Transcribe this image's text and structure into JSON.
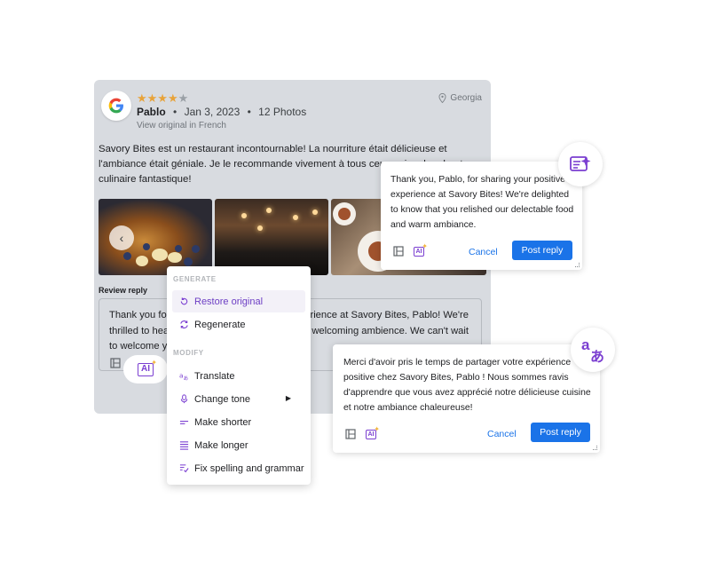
{
  "review": {
    "stars_filled": "★★★★",
    "stars_empty": "★",
    "rating": 4,
    "author": "Pablo",
    "date": "Jan 3, 2023",
    "photos_count": "12 Photos",
    "view_original": "View original in French",
    "location": "Georgia",
    "text": "Savory Bites est un restaurant incontournable! La nourriture était délicieuse et l'ambiance était géniale. Je le recommande vivement à tous ceux qui recherchent",
    "text_end": "culinaire fantastique!",
    "reply_label": "Review reply",
    "reply_text_left": "Thank you for t",
    "reply_text_right_1": "experience at Savory Bites, Pablo! We're",
    "reply_text_line2_left": "thrilled to hear",
    "reply_text_right_2": "and welcoming ambience. We can't wait",
    "reply_text_line3": "to welcome yo",
    "ai_label": "AI"
  },
  "menu": {
    "generate_header": "GENERATE",
    "modify_header": "MODIFY",
    "items": [
      {
        "label": "Restore original",
        "icon": "restore-icon",
        "active": true
      },
      {
        "label": "Regenerate",
        "icon": "regenerate-icon"
      },
      {
        "label": "Translate",
        "icon": "translate-icon"
      },
      {
        "label": "Change tone",
        "icon": "tone-icon",
        "submenu": "▶"
      },
      {
        "label": "Make shorter",
        "icon": "shorter-icon"
      },
      {
        "label": "Make longer",
        "icon": "longer-icon"
      },
      {
        "label": "Fix spelling and grammar",
        "icon": "spellcheck-icon"
      }
    ]
  },
  "card_en": {
    "text": "Thank you, Pablo, for sharing your positive experience at Savory Bites! We're delighted to know that you relished our delectable food and warm ambiance.",
    "cancel": "Cancel",
    "post": "Post reply",
    "ai_label": "AI"
  },
  "card_fr": {
    "text": "Merci d'avoir pris le temps de partager votre expérience positive chez Savory Bites, Pablo ! Nous sommes ravis d'apprendre que vous avez apprécié notre délicieuse cuisine et notre ambiance chaleureuse!",
    "cancel": "Cancel",
    "post": "Post reply",
    "ai_label": "AI"
  },
  "badges": {
    "translate_a": "a",
    "translate_b": "あ"
  },
  "colors": {
    "accent_purple": "#7b3fd1",
    "primary_blue": "#1a73e8",
    "star_gold": "#e8a33a",
    "card_gray": "#d8dbe0"
  }
}
